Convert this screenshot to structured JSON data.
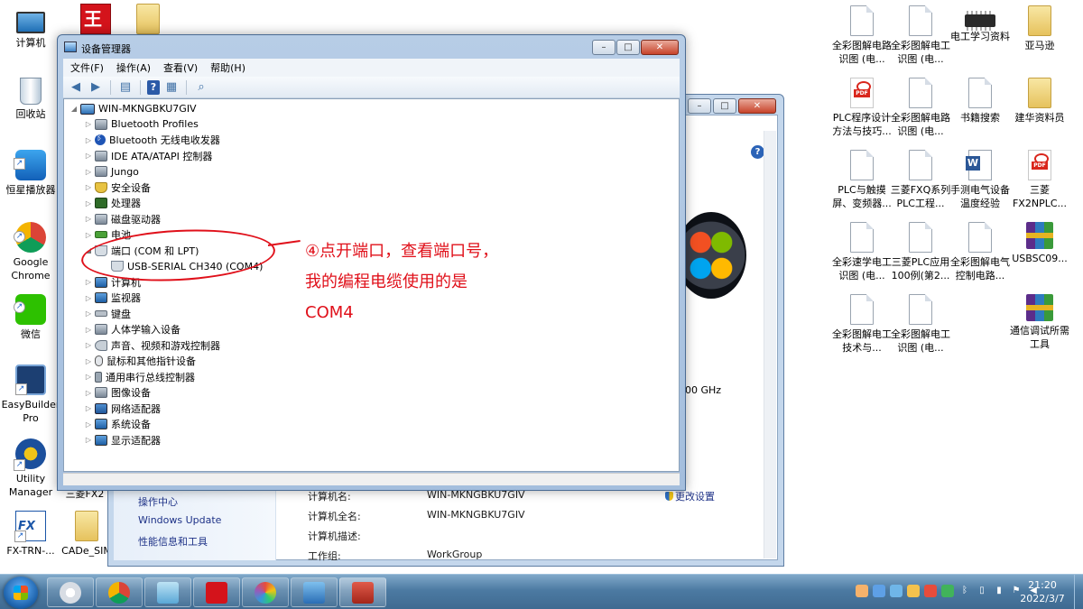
{
  "desktop_left": [
    {
      "label": "计算机",
      "icon": "computer-icon"
    },
    {
      "label": "回收站",
      "icon": "recycle-bin-icon"
    },
    {
      "label": "恒星播放器",
      "icon": "media-player-icon"
    },
    {
      "label": "Google Chrome",
      "icon": "chrome-icon"
    },
    {
      "label": "微信",
      "icon": "wechat-icon"
    },
    {
      "label": "EasyBuilder Pro",
      "icon": "easybuilder-icon"
    },
    {
      "label": "Utility Manager",
      "icon": "utility-icon"
    },
    {
      "label": "FX-TRN-...",
      "icon": "fx-trn-icon"
    }
  ],
  "desktop_col2_label": "CADe_SIM",
  "desktop_col2_partial": "三菱FX2",
  "desktop_right": [
    {
      "label": "全彩图解电路识图 (电...",
      "icon": "document-icon"
    },
    {
      "label": "全彩图解电工识图 (电...",
      "icon": "document-icon"
    },
    {
      "label": "电工学习资料",
      "icon": "chip-icon"
    },
    {
      "label": "亚马逊",
      "icon": "folder-icon"
    },
    {
      "label": "PLC程序设计方法与技巧...",
      "icon": "pdf-icon"
    },
    {
      "label": "全彩图解电路识图 (电...",
      "icon": "document-icon"
    },
    {
      "label": "书籍搜索",
      "icon": "document-icon"
    },
    {
      "label": "建华资料员",
      "icon": "folder-icon"
    },
    {
      "label": "PLC与触摸屏、变频器...",
      "icon": "document-icon"
    },
    {
      "label": "三菱FXQ系列PLC工程...",
      "icon": "document-icon"
    },
    {
      "label": "手测电气设备温度经验",
      "icon": "word-icon"
    },
    {
      "label": "三菱FX2NPLC...",
      "icon": "pdf-icon"
    },
    {
      "label": "全彩速学电工识图 (电...",
      "icon": "document-icon"
    },
    {
      "label": "三菱PLC应用100例(第2...",
      "icon": "document-icon"
    },
    {
      "label": "全彩图解电气控制电路...",
      "icon": "document-icon"
    },
    {
      "label": "USBSC09...",
      "icon": "rar-icon"
    },
    {
      "label": "全彩图解电工技术与...",
      "icon": "document-icon"
    },
    {
      "label": "全彩图解电工识图 (电...",
      "icon": "document-icon"
    },
    {
      "label": "通信调试所需工具",
      "icon": "rar-icon"
    }
  ],
  "device_manager": {
    "title": "设备管理器",
    "menu": [
      "文件(F)",
      "操作(A)",
      "查看(V)",
      "帮助(H)"
    ],
    "root": "WIN-MKNGBKU7GIV",
    "tree": [
      {
        "label": "Bluetooth Profiles",
        "icon": "generic"
      },
      {
        "label": "Bluetooth 无线电收发器",
        "icon": "bt"
      },
      {
        "label": "IDE ATA/ATAPI 控制器",
        "icon": "generic"
      },
      {
        "label": "Jungo",
        "icon": "generic"
      },
      {
        "label": "安全设备",
        "icon": "shield"
      },
      {
        "label": "处理器",
        "icon": "cpu"
      },
      {
        "label": "磁盘驱动器",
        "icon": "generic"
      },
      {
        "label": "电池",
        "icon": "batt"
      },
      {
        "label": "端口 (COM 和 LPT)",
        "icon": "port",
        "expanded": true
      },
      {
        "label": "USB-SERIAL CH340 (COM4)",
        "icon": "port",
        "child": true
      },
      {
        "label": "计算机",
        "icon": "monitor"
      },
      {
        "label": "监视器",
        "icon": "monitor"
      },
      {
        "label": "键盘",
        "icon": "keyboard"
      },
      {
        "label": "人体学输入设备",
        "icon": "generic"
      },
      {
        "label": "声音、视频和游戏控制器",
        "icon": "sound"
      },
      {
        "label": "鼠标和其他指针设备",
        "icon": "mouse"
      },
      {
        "label": "通用串行总线控制器",
        "icon": "usb"
      },
      {
        "label": "图像设备",
        "icon": "generic"
      },
      {
        "label": "网络适配器",
        "icon": "net"
      },
      {
        "label": "系统设备",
        "icon": "monitor"
      },
      {
        "label": "显示适配器",
        "icon": "monitor"
      }
    ]
  },
  "annotation": {
    "text": "④点开端口，查看端口号，我的编程电缆使用的是COM4",
    "color": "#e0101a"
  },
  "system_window": {
    "left_links": [
      "操作中心",
      "Windows Update",
      "性能信息和工具"
    ],
    "info": [
      {
        "label": "计算机名:",
        "value": "WIN-MKNGBKU7GIV"
      },
      {
        "label": "计算机全名:",
        "value": "WIN-MKNGBKU7GIV"
      },
      {
        "label": "计算机描述:",
        "value": ""
      },
      {
        "label": "工作组:",
        "value": "WorkGroup"
      }
    ],
    "change_settings": "更改设置",
    "ghz_fragment": "00 GHz",
    "help": "?"
  },
  "taskbar": {
    "time": "21:20",
    "date": "2022/3/7"
  }
}
